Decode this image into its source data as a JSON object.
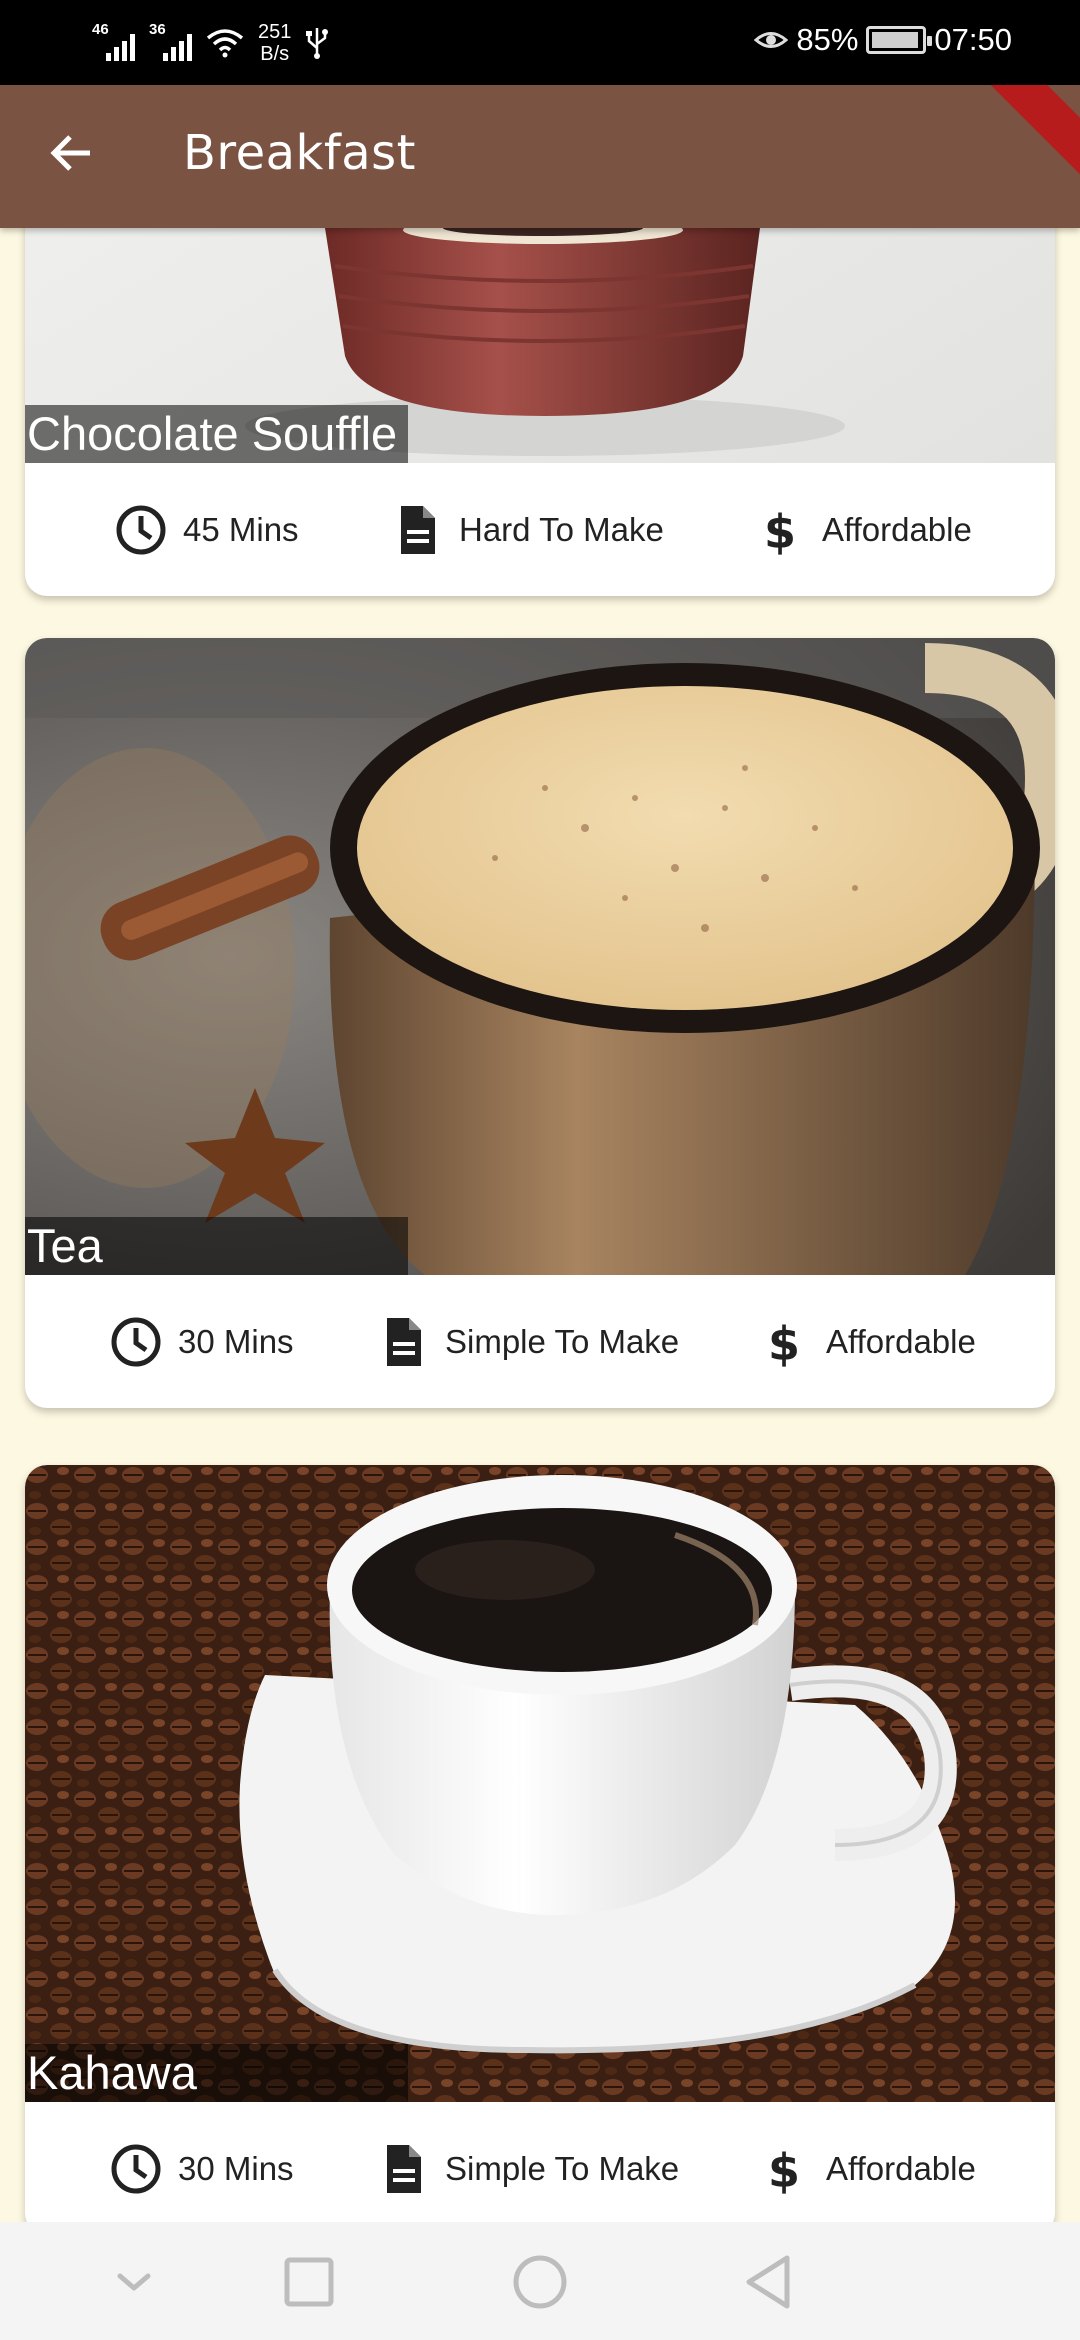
{
  "status_bar": {
    "sim1_tag": "46",
    "sim2_tag": "36",
    "net_speed_value": "251",
    "net_speed_unit": "B/s",
    "battery_percent": "85%",
    "time": "07:50"
  },
  "app_bar": {
    "title": "Breakfast"
  },
  "meals": [
    {
      "title": "Chocolate Souffle",
      "duration": "45 Mins",
      "complexity": "Hard To Make",
      "affordability": "Affordable"
    },
    {
      "title": "Tea",
      "duration": "30 Mins",
      "complexity": "Simple To Make",
      "affordability": "Affordable"
    },
    {
      "title": "Kahawa",
      "duration": "30 Mins",
      "complexity": "Simple To Make",
      "affordability": "Affordable"
    }
  ],
  "icons": {
    "duration": "clock-icon",
    "complexity": "document-icon",
    "affordability": "dollar-icon",
    "back": "arrow-left-icon"
  },
  "colors": {
    "app_bar": "#7b5343",
    "background": "#fdf8e1",
    "card": "#ffffff",
    "title_overlay": "rgba(0,0,0,0.54)"
  }
}
